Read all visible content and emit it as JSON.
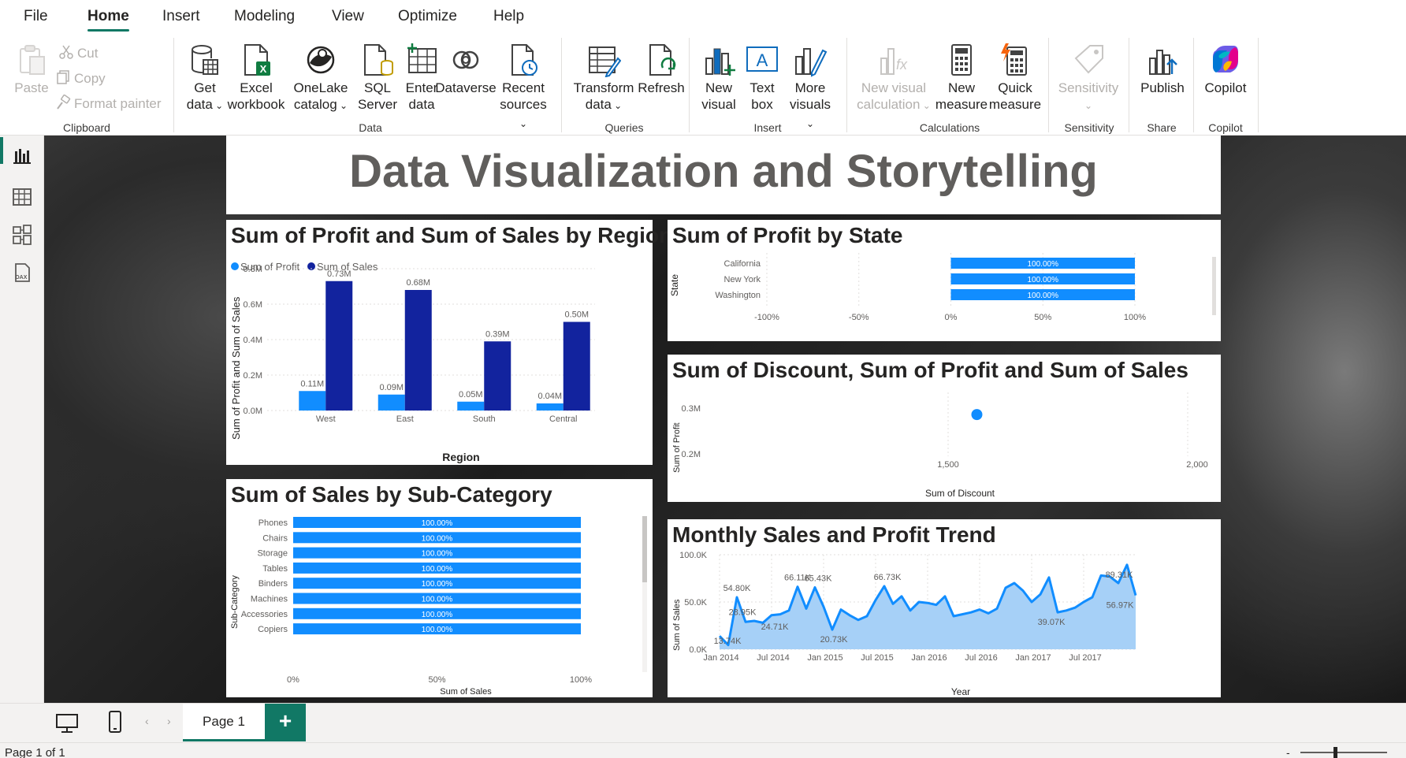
{
  "menu": {
    "items": [
      "File",
      "Home",
      "Insert",
      "Modeling",
      "View",
      "Optimize",
      "Help"
    ],
    "active": "Home"
  },
  "ribbon": {
    "clipboard": {
      "paste": "Paste",
      "cut": "Cut",
      "copy": "Copy",
      "format_painter": "Format painter",
      "group": "Clipboard"
    },
    "data": {
      "get_data": [
        "Get",
        "data"
      ],
      "excel": [
        "Excel",
        "workbook"
      ],
      "onelake": [
        "OneLake",
        "catalog"
      ],
      "sql": [
        "SQL",
        "Server"
      ],
      "enter": [
        "Enter",
        "data"
      ],
      "dataverse": [
        "Dataverse"
      ],
      "recent": [
        "Recent",
        "sources"
      ],
      "group": "Data"
    },
    "queries": {
      "transform": [
        "Transform",
        "data"
      ],
      "refresh": [
        "Refresh"
      ],
      "group": "Queries"
    },
    "insert": {
      "new_visual": [
        "New",
        "visual"
      ],
      "text_box": [
        "Text",
        "box"
      ],
      "more": [
        "More",
        "visuals"
      ],
      "group": "Insert"
    },
    "calculations": {
      "new_visual_calc": [
        "New visual",
        "calculation"
      ],
      "new_measure": [
        "New",
        "measure"
      ],
      "quick_measure": [
        "Quick",
        "measure"
      ],
      "group": "Calculations"
    },
    "sensitivity": {
      "label": "Sensitivity",
      "group": "Sensitivity"
    },
    "share": {
      "publish": "Publish",
      "group": "Share"
    },
    "copilot": {
      "label": "Copilot",
      "group": "Copilot"
    }
  },
  "report": {
    "title": "Data Visualization and Storytelling"
  },
  "visuals": {
    "region": {
      "title": "Sum of Profit and Sum of Sales by Region",
      "legend": [
        "Sum of Profit",
        "Sum of Sales"
      ],
      "xlabel": "Region",
      "ylabel": "Sum of Profit and Sum of Sales"
    },
    "state": {
      "title": "Sum of Profit by State",
      "ylabel": "State"
    },
    "scatter": {
      "title": "Sum of Discount, Sum of Profit and Sum of Sales",
      "xlabel": "Sum of Discount",
      "ylabel": "Sum of Profit"
    },
    "subcat": {
      "title": "Sum of Sales by Sub-Category",
      "xlabel": "Sum of Sales",
      "ylabel": "Sub-Category"
    },
    "trend": {
      "title": "Monthly Sales and Profit Trend",
      "xlabel": "Year",
      "ylabel": "Sum of Sales"
    }
  },
  "colors": {
    "profit": "#118dff",
    "sales": "#12239e",
    "area": "#a6d0f7",
    "line": "#118dff",
    "accent": "#117865"
  },
  "chart_data": [
    {
      "type": "bar",
      "title": "Sum of Profit and Sum of Sales by Region",
      "categories": [
        "West",
        "East",
        "South",
        "Central"
      ],
      "series": [
        {
          "name": "Sum of Profit",
          "values": [
            0.11,
            0.09,
            0.05,
            0.04
          ],
          "labels": [
            "0.11M",
            "0.09M",
            "0.05M",
            "0.04M"
          ]
        },
        {
          "name": "Sum of Sales",
          "values": [
            0.73,
            0.68,
            0.39,
            0.5
          ],
          "labels": [
            "0.73M",
            "0.68M",
            "0.39M",
            "0.50M"
          ]
        }
      ],
      "ylim": [
        0,
        0.8
      ],
      "yticks": [
        "0.0M",
        "0.2M",
        "0.4M",
        "0.6M",
        "0.8M"
      ],
      "xlabel": "Region",
      "ylabel": "Sum of Profit and Sum of Sales",
      "legend": "top-left",
      "grid": true
    },
    {
      "type": "bar",
      "orientation": "horizontal",
      "title": "Sum of Profit by State",
      "categories": [
        "California",
        "New York",
        "Washington"
      ],
      "values": [
        100,
        100,
        100
      ],
      "labels": [
        "100.00%",
        "100.00%",
        "100.00%"
      ],
      "xlim": [
        -100,
        100
      ],
      "xticks": [
        "-100%",
        "-50%",
        "0%",
        "50%",
        "100%"
      ],
      "ylabel": "State"
    },
    {
      "type": "scatter",
      "title": "Sum of Discount, Sum of Profit and Sum of Sales",
      "points": [
        {
          "x": 1560,
          "y": 0.286
        }
      ],
      "xlim": [
        1000,
        2000
      ],
      "xticks": [
        "1,500",
        "2,000"
      ],
      "ylim": [
        0.2,
        0.3
      ],
      "yticks": [
        "0.2M",
        "0.3M"
      ],
      "xlabel": "Sum of Discount",
      "ylabel": "Sum of Profit"
    },
    {
      "type": "bar",
      "orientation": "horizontal",
      "title": "Sum of Sales by Sub-Category",
      "categories": [
        "Phones",
        "Chairs",
        "Storage",
        "Tables",
        "Binders",
        "Machines",
        "Accessories",
        "Copiers"
      ],
      "values": [
        100,
        100,
        100,
        100,
        100,
        100,
        100,
        100
      ],
      "labels": [
        "100.00%",
        "100.00%",
        "100.00%",
        "100.00%",
        "100.00%",
        "100.00%",
        "100.00%",
        "100.00%"
      ],
      "xlim": [
        0,
        100
      ],
      "xticks": [
        "0%",
        "50%",
        "100%"
      ],
      "xlabel": "Sum of Sales",
      "ylabel": "Sub-Category"
    },
    {
      "type": "area",
      "title": "Monthly Sales and Profit Trend",
      "x_start": "Jan 2014",
      "xticks": [
        "Jan 2014",
        "Jul 2014",
        "Jan 2015",
        "Jul 2015",
        "Jan 2016",
        "Jul 2016",
        "Jan 2017",
        "Jul 2017"
      ],
      "values": [
        14,
        4.5,
        55,
        28.95,
        30,
        28,
        36,
        37,
        41,
        66.11,
        43,
        65.43,
        45,
        20.73,
        42,
        36,
        31,
        35,
        52,
        66.73,
        48,
        56,
        41,
        50,
        49,
        47,
        56,
        35,
        37,
        39,
        42,
        38,
        43,
        65,
        70,
        62,
        50,
        58,
        76,
        39.07,
        41,
        44,
        50,
        55,
        78,
        77,
        70,
        89.31,
        56.97
      ],
      "point_labels": [
        {
          "index": 0,
          "text": "13.74K"
        },
        {
          "index": 2,
          "text": "54.80K"
        },
        {
          "index": 3,
          "text": "28.95K"
        },
        {
          "index": 6,
          "text": "24.71K"
        },
        {
          "index": 9,
          "text": "66.11K"
        },
        {
          "index": 11,
          "text": "65.43K"
        },
        {
          "index": 13,
          "text": "20.73K"
        },
        {
          "index": 19,
          "text": "66.73K"
        },
        {
          "index": 39,
          "text": "39.07K"
        },
        {
          "index": 47,
          "text": "89.31K"
        },
        {
          "index": 48,
          "text": "56.97K"
        }
      ],
      "ylim": [
        0,
        100
      ],
      "yticks": [
        "0.0K",
        "50.0K",
        "100.0K"
      ],
      "xlabel": "Year",
      "ylabel": "Sum of Sales"
    }
  ],
  "bottom": {
    "page_tab": "Page 1",
    "add": "+",
    "status": "Page 1 of 1"
  }
}
